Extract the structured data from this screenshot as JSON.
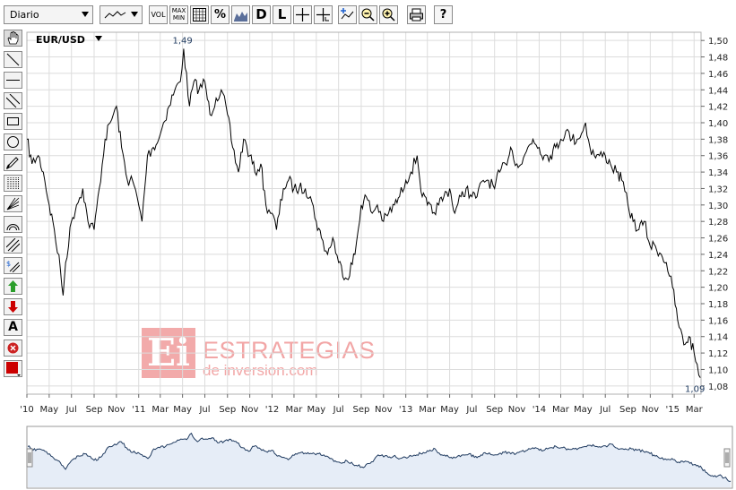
{
  "toolbar": {
    "period_select": "Diario",
    "buttons": {
      "vol": "VOL",
      "maxmin_top": "MAX",
      "maxmin_bottom": "MIN",
      "percent": "%",
      "daily": "D",
      "log": "L"
    }
  },
  "watermark": {
    "logo_letters": "Ei",
    "line1": "ESTRATEGIAS",
    "line2": "de inversion.com"
  },
  "colors": {
    "line": "#000000",
    "grid": "#dcdcdc",
    "watermark": "#f2aaaa",
    "navigator_fill": "#e6edf7",
    "navigator_line": "#1f3a5f",
    "tool_red": "#cc0000",
    "tool_green": "#2a9d2a"
  },
  "side_tools": [
    "hand-icon",
    "trendline-icon",
    "horizontal-line-icon",
    "parallel-lines-icon",
    "rectangle-icon",
    "circle-icon",
    "pencil-icon",
    "fibonacci-icon",
    "gann-fan-icon",
    "arc-icon",
    "channel-icon",
    "dollar-channel-icon",
    "buy-arrow-icon",
    "sell-arrow-icon",
    "text-tool-icon",
    "delete-icon",
    "color-picker-icon"
  ],
  "chart_data": {
    "type": "line",
    "title": "EUR/USD",
    "ylim": [
      1.07,
      1.51
    ],
    "yticks": [
      "1,50",
      "1,48",
      "1,46",
      "1,44",
      "1,42",
      "1,40",
      "1,38",
      "1,36",
      "1,34",
      "1,32",
      "1,30",
      "1,28",
      "1,26",
      "1,24",
      "1,22",
      "1,20",
      "1,18",
      "1,16",
      "1,14",
      "1,12",
      "1,10",
      "1,08"
    ],
    "xlim": [
      "2010-03-01",
      "2015-03-20"
    ],
    "xticks": [
      {
        "label": "'10",
        "date": "2010-03-01"
      },
      {
        "label": "May",
        "date": "2010-05-01"
      },
      {
        "label": "Jul",
        "date": "2010-07-01"
      },
      {
        "label": "Sep",
        "date": "2010-09-01"
      },
      {
        "label": "Nov",
        "date": "2010-11-01"
      },
      {
        "label": "'11",
        "date": "2011-01-01"
      },
      {
        "label": "Mar",
        "date": "2011-03-01"
      },
      {
        "label": "May",
        "date": "2011-05-01"
      },
      {
        "label": "Jul",
        "date": "2011-07-01"
      },
      {
        "label": "Sep",
        "date": "2011-09-01"
      },
      {
        "label": "Nov",
        "date": "2011-11-01"
      },
      {
        "label": "'12",
        "date": "2012-01-01"
      },
      {
        "label": "Mar",
        "date": "2012-03-01"
      },
      {
        "label": "May",
        "date": "2012-05-01"
      },
      {
        "label": "Jul",
        "date": "2012-07-01"
      },
      {
        "label": "Sep",
        "date": "2012-09-01"
      },
      {
        "label": "Nov",
        "date": "2012-11-01"
      },
      {
        "label": "'13",
        "date": "2013-01-01"
      },
      {
        "label": "Mar",
        "date": "2013-03-01"
      },
      {
        "label": "May",
        "date": "2013-05-01"
      },
      {
        "label": "Jul",
        "date": "2013-07-01"
      },
      {
        "label": "Sep",
        "date": "2013-09-01"
      },
      {
        "label": "Nov",
        "date": "2013-11-01"
      },
      {
        "label": "'14",
        "date": "2014-01-01"
      },
      {
        "label": "Mar",
        "date": "2014-03-01"
      },
      {
        "label": "May",
        "date": "2014-05-01"
      },
      {
        "label": "Jul",
        "date": "2014-07-01"
      },
      {
        "label": "Sep",
        "date": "2014-09-01"
      },
      {
        "label": "Nov",
        "date": "2014-11-01"
      },
      {
        "label": "'15",
        "date": "2015-01-01"
      },
      {
        "label": "Mar",
        "date": "2015-03-01"
      }
    ],
    "grid": true,
    "annotations": [
      {
        "label": "1,49",
        "date": "2011-05-01",
        "value": 1.49
      },
      {
        "label": "1,09",
        "date": "2015-03-18",
        "value": 1.09
      }
    ],
    "series": [
      {
        "dates": [
          "2010-03-01",
          "2010-03-15",
          "2010-04-01",
          "2010-04-15",
          "2010-05-01",
          "2010-05-15",
          "2010-06-01",
          "2010-06-08",
          "2010-06-15",
          "2010-07-01",
          "2010-07-15",
          "2010-08-01",
          "2010-08-15",
          "2010-09-01",
          "2010-09-15",
          "2010-10-01",
          "2010-10-15",
          "2010-11-01",
          "2010-11-15",
          "2010-12-01",
          "2010-12-15",
          "2011-01-01",
          "2011-01-10",
          "2011-01-25",
          "2011-02-10",
          "2011-02-25",
          "2011-03-10",
          "2011-03-25",
          "2011-04-10",
          "2011-04-25",
          "2011-05-04",
          "2011-05-20",
          "2011-06-01",
          "2011-06-15",
          "2011-07-01",
          "2011-07-15",
          "2011-08-01",
          "2011-08-15",
          "2011-09-01",
          "2011-09-15",
          "2011-10-01",
          "2011-10-15",
          "2011-11-01",
          "2011-11-15",
          "2011-12-01",
          "2011-12-15",
          "2012-01-01",
          "2012-01-13",
          "2012-02-01",
          "2012-02-15",
          "2012-03-01",
          "2012-03-15",
          "2012-04-01",
          "2012-04-15",
          "2012-05-01",
          "2012-05-15",
          "2012-06-01",
          "2012-06-15",
          "2012-07-01",
          "2012-07-24",
          "2012-08-15",
          "2012-09-01",
          "2012-09-15",
          "2012-10-01",
          "2012-10-15",
          "2012-11-01",
          "2012-11-15",
          "2012-12-01",
          "2012-12-15",
          "2013-01-01",
          "2013-01-15",
          "2013-02-01",
          "2013-02-15",
          "2013-03-01",
          "2013-03-15",
          "2013-04-01",
          "2013-04-15",
          "2013-05-01",
          "2013-05-15",
          "2013-06-01",
          "2013-06-15",
          "2013-07-01",
          "2013-07-15",
          "2013-08-01",
          "2013-08-15",
          "2013-09-01",
          "2013-09-15",
          "2013-10-01",
          "2013-10-15",
          "2013-11-01",
          "2013-11-15",
          "2013-12-01",
          "2013-12-15",
          "2014-01-01",
          "2014-01-15",
          "2014-02-01",
          "2014-02-15",
          "2014-03-01",
          "2014-03-15",
          "2014-04-01",
          "2014-04-15",
          "2014-05-01",
          "2014-05-08",
          "2014-05-20",
          "2014-06-01",
          "2014-06-15",
          "2014-07-01",
          "2014-07-15",
          "2014-08-01",
          "2014-08-15",
          "2014-09-01",
          "2014-09-15",
          "2014-10-01",
          "2014-10-15",
          "2014-11-01",
          "2014-11-15",
          "2014-12-01",
          "2014-12-15",
          "2015-01-01",
          "2015-01-15",
          "2015-02-01",
          "2015-02-15",
          "2015-03-01",
          "2015-03-18"
        ],
        "values": [
          1.38,
          1.35,
          1.36,
          1.34,
          1.3,
          1.27,
          1.22,
          1.19,
          1.23,
          1.28,
          1.3,
          1.32,
          1.28,
          1.27,
          1.32,
          1.38,
          1.4,
          1.42,
          1.37,
          1.33,
          1.33,
          1.3,
          1.28,
          1.36,
          1.37,
          1.38,
          1.4,
          1.42,
          1.44,
          1.45,
          1.49,
          1.42,
          1.45,
          1.44,
          1.45,
          1.41,
          1.43,
          1.44,
          1.41,
          1.37,
          1.34,
          1.38,
          1.36,
          1.34,
          1.35,
          1.3,
          1.29,
          1.27,
          1.32,
          1.33,
          1.32,
          1.32,
          1.32,
          1.31,
          1.28,
          1.26,
          1.24,
          1.26,
          1.23,
          1.21,
          1.24,
          1.3,
          1.31,
          1.29,
          1.3,
          1.28,
          1.29,
          1.3,
          1.31,
          1.33,
          1.34,
          1.36,
          1.31,
          1.3,
          1.29,
          1.3,
          1.31,
          1.32,
          1.29,
          1.31,
          1.32,
          1.31,
          1.31,
          1.33,
          1.33,
          1.32,
          1.34,
          1.35,
          1.37,
          1.35,
          1.35,
          1.37,
          1.38,
          1.37,
          1.36,
          1.36,
          1.37,
          1.38,
          1.39,
          1.38,
          1.38,
          1.39,
          1.4,
          1.37,
          1.36,
          1.36,
          1.36,
          1.35,
          1.34,
          1.33,
          1.3,
          1.28,
          1.27,
          1.28,
          1.25,
          1.25,
          1.24,
          1.23,
          1.2,
          1.16,
          1.13,
          1.14,
          1.12,
          1.09
        ]
      }
    ]
  }
}
